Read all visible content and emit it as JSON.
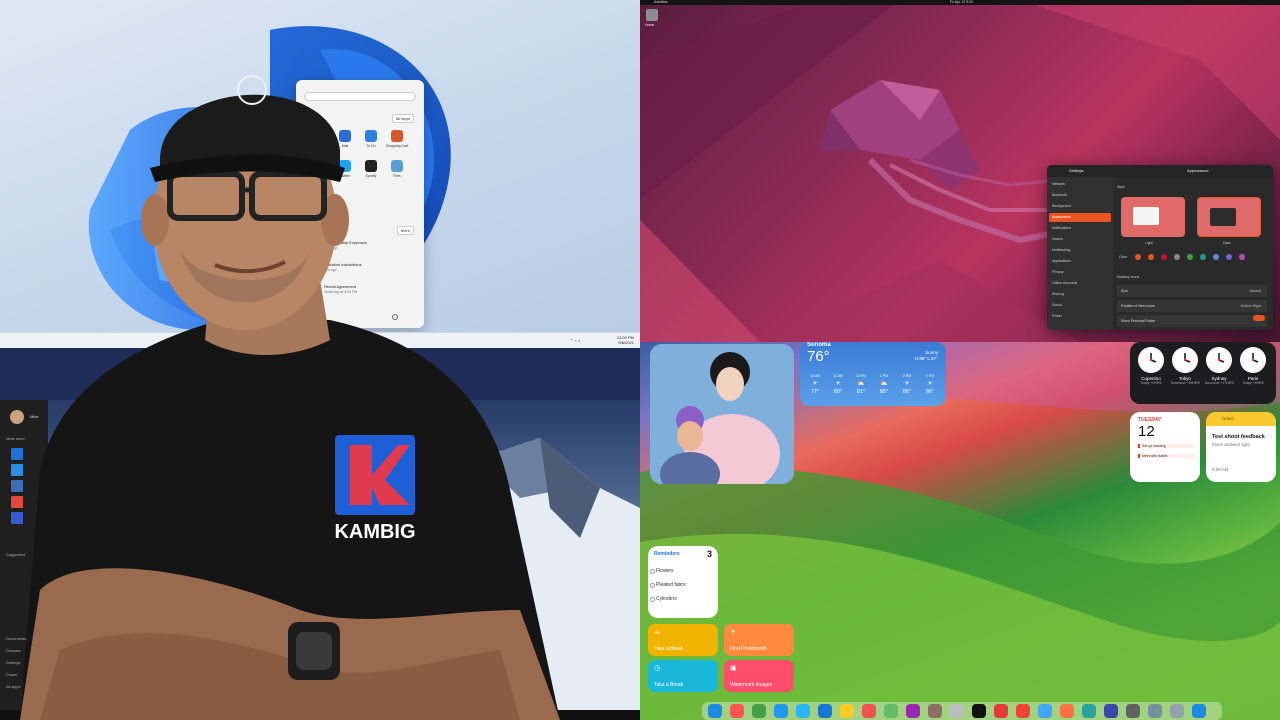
{
  "win11": {
    "start_menu": {
      "all_apps_label": "All apps",
      "more_label": "More",
      "pinned": [
        {
          "label": "Mail",
          "color": "#2b6cd6"
        },
        {
          "label": "To Do",
          "color": "#2f7ee0"
        },
        {
          "label": "Shopping Cart",
          "color": "#d45a2a"
        },
        {
          "label": "Pinterest",
          "color": "#e60023"
        },
        {
          "label": "Twitter",
          "color": "#1da1f2"
        },
        {
          "label": "Spotify",
          "color": "#222222"
        },
        {
          "label": "Files",
          "color": "#56a0d3"
        }
      ],
      "recommended": [
        {
          "title": "2021 Monthly Expenses",
          "sub": "17m ago"
        },
        {
          "title": "Donation Instructions",
          "sub": "12h ago"
        },
        {
          "title": "Rental Agreement",
          "sub": "Yesterday at 4:24 PM"
        }
      ]
    },
    "clock_time": "12:00 PM",
    "clock_date": "9/8/2021"
  },
  "ubuntu": {
    "topbar_activities": "Activities",
    "topbar_clock": "Fri Apr 12 9:00",
    "home_label": "Home",
    "settings": {
      "sidebar_title": "Settings",
      "panel_title": "Appearance",
      "sidebar_items": [
        "Network",
        "Bluetooth",
        "Background",
        "Appearance",
        "Notifications",
        "Search",
        "Multitasking",
        "Applications",
        "Privacy",
        "Online Accounts",
        "Sharing",
        "Sound",
        "Power"
      ],
      "style_label": "Style",
      "light_label": "Light",
      "dark_label": "Dark",
      "color_label": "Color",
      "accent_colors": [
        "#e95420",
        "#e95420",
        "#c7162b",
        "#8a8a8a",
        "#3e9f46",
        "#1f9d8a",
        "#5f8dd3",
        "#7764d8",
        "#b34cb3"
      ],
      "desktop_icons_label": "Desktop Icons",
      "rows": [
        {
          "label": "Size",
          "value": "Normal"
        },
        {
          "label": "Position of New Icons",
          "value": "Bottom Right"
        },
        {
          "label": "Show Personal Folder",
          "value": ""
        }
      ]
    }
  },
  "win10": {
    "user_name": "Mike",
    "most_used_label": "Most used",
    "suggested_label": "Suggested",
    "side_items": [
      "Documents",
      "Pictures",
      "Settings",
      "Power",
      "All Apps"
    ]
  },
  "presenter": {
    "shirt_text": "KAMBIG"
  },
  "mac": {
    "weather": {
      "city": "Sonoma",
      "temp": "76°",
      "condition": "Sunny",
      "hilo": "H:88° L:57°",
      "hours": [
        {
          "time": "10 AM",
          "temp": "77°",
          "icon": "☀"
        },
        {
          "time": "11 AM",
          "temp": "80°",
          "icon": "☀"
        },
        {
          "time": "12 PM",
          "temp": "81°",
          "icon": "⛅"
        },
        {
          "time": "1 PM",
          "temp": "85°",
          "icon": "⛅"
        },
        {
          "time": "2 PM",
          "temp": "86°",
          "icon": "☀"
        },
        {
          "time": "3 PM",
          "temp": "86°",
          "icon": "☀"
        }
      ]
    },
    "clocks": [
      {
        "city": "Cupertino",
        "sub": "Today +0HRS"
      },
      {
        "city": "Tokyo",
        "sub": "Tomorrow +16HRS"
      },
      {
        "city": "Sydney",
        "sub": "Tomorrow +17HRS"
      },
      {
        "city": "Paris",
        "sub": "Today +9HRS"
      }
    ],
    "calendar": {
      "dow": "TUESDAY",
      "day": "12",
      "events": [
        "Set up meeting",
        "Meet with Isabel"
      ]
    },
    "notes": {
      "header": "Notes",
      "title": "Test shoot feedback",
      "body": "Move ambient light",
      "time": "8:00 AM"
    },
    "reminders": {
      "title": "Reminders",
      "count": "3",
      "items": [
        "Flowers",
        "Pleated fabric",
        "Cylinders"
      ]
    },
    "shortcuts": [
      {
        "label": "Take a Break",
        "icon": "☕",
        "color": "#f0b400"
      },
      {
        "label": "Find Photobooth",
        "icon": "✦",
        "color": "#ff8a3d"
      },
      {
        "label": "Take a Break",
        "icon": "◷",
        "color": "#19b8d8"
      },
      {
        "label": "Watermark Images",
        "icon": "▣",
        "color": "#ff4d6d"
      }
    ],
    "dock_colors": [
      "#1e88e5",
      "#ff5252",
      "#43a047",
      "#2196f3",
      "#29b6f6",
      "#1976d2",
      "#ffca28",
      "#ef5350",
      "#66bb6a",
      "#9c27b0",
      "#8d6e63",
      "#bdbdbd",
      "#111111",
      "#e53935",
      "#f44336",
      "#42a5f5",
      "#ff7043",
      "#26a69a",
      "#3949ab",
      "#616161",
      "#78909c",
      "#90a4ae",
      "#1e88e5"
    ]
  }
}
